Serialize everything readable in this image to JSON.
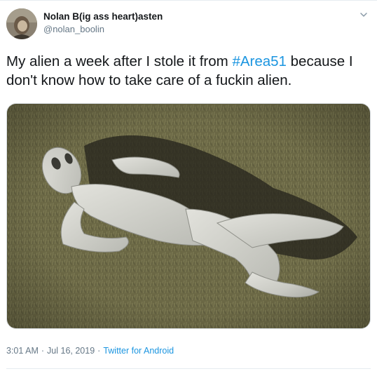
{
  "tweet": {
    "author": {
      "display_name": "Nolan B(ig ass heart)asten",
      "handle": "@nolan_boolin"
    },
    "text_before": "My alien a week after I stole it from ",
    "hashtag": "#Area51",
    "text_after": " because I don't know how to take care of a fuckin alien.",
    "time": "3:01 AM",
    "date": "Jul 16, 2019",
    "separator": "·",
    "source": "Twitter for Android"
  },
  "colors": {
    "link": "#1b95e0",
    "secondary_text": "#657786",
    "primary_text": "#14171a"
  },
  "icons": [
    "chevron-down-icon"
  ]
}
